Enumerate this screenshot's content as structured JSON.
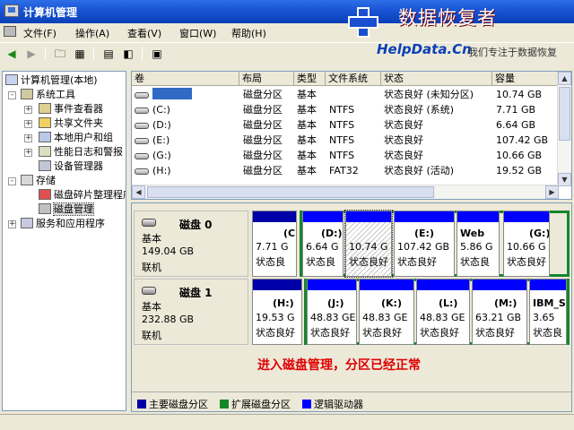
{
  "window": {
    "title": "计算机管理"
  },
  "brand": {
    "cn_name": "数据恢复者",
    "en_name": "HelpData.Cn",
    "slogan": "我们专注于数据恢复"
  },
  "menu": [
    {
      "label": "文件(F)",
      "name": "menu-file"
    },
    {
      "label": "操作(A)",
      "name": "menu-action"
    },
    {
      "label": "查看(V)",
      "name": "menu-view"
    },
    {
      "label": "窗口(W)",
      "name": "menu-window"
    },
    {
      "label": "帮助(H)",
      "name": "menu-help"
    }
  ],
  "toolbar": {
    "back": "back-arrow-icon",
    "forward": "forward-arrow-icon",
    "up": "up-folder-icon",
    "tree": "show-tree-icon",
    "properties": "properties-icon",
    "help": "help-icon",
    "export": "export-list-icon"
  },
  "tree": {
    "root": "计算机管理(本地)",
    "nodes": [
      {
        "label": "系统工具",
        "level": 1,
        "expander": "-"
      },
      {
        "label": "事件查看器",
        "level": 2,
        "expander": "+"
      },
      {
        "label": "共享文件夹",
        "level": 2,
        "expander": "+"
      },
      {
        "label": "本地用户和组",
        "level": 2,
        "expander": "+"
      },
      {
        "label": "性能日志和警报",
        "level": 2,
        "expander": "+"
      },
      {
        "label": "设备管理器",
        "level": 2,
        "expander": ""
      },
      {
        "label": "存储",
        "level": 1,
        "expander": "-"
      },
      {
        "label": "磁盘碎片整理程序",
        "level": 2,
        "expander": ""
      },
      {
        "label": "磁盘管理",
        "level": 2,
        "expander": "",
        "selected": true
      },
      {
        "label": "服务和应用程序",
        "level": 1,
        "expander": "+"
      }
    ]
  },
  "volume_list": {
    "columns": [
      "卷",
      "布局",
      "类型",
      "文件系统",
      "状态",
      "容量"
    ],
    "rows": [
      {
        "volume": "",
        "layout": "磁盘分区",
        "type": "基本",
        "fs": "",
        "status": "状态良好 (未知分区)",
        "capacity": "10.74 GB"
      },
      {
        "volume": "(C:)",
        "layout": "磁盘分区",
        "type": "基本",
        "fs": "NTFS",
        "status": "状态良好 (系统)",
        "capacity": "7.71 GB"
      },
      {
        "volume": "(D:)",
        "layout": "磁盘分区",
        "type": "基本",
        "fs": "NTFS",
        "status": "状态良好",
        "capacity": "6.64 GB"
      },
      {
        "volume": "(E:)",
        "layout": "磁盘分区",
        "type": "基本",
        "fs": "NTFS",
        "status": "状态良好",
        "capacity": "107.42 GB"
      },
      {
        "volume": "(G:)",
        "layout": "磁盘分区",
        "type": "基本",
        "fs": "NTFS",
        "status": "状态良好",
        "capacity": "10.66 GB"
      },
      {
        "volume": "(H:)",
        "layout": "磁盘分区",
        "type": "基本",
        "fs": "FAT32",
        "status": "状态良好 (活动)",
        "capacity": "19.52 GB"
      }
    ]
  },
  "disks": [
    {
      "name": "磁盘 0",
      "kind": "基本",
      "size": "149.04 GB",
      "state": "联机",
      "partitions": [
        {
          "label": "(C:)",
          "size": "7.71 G",
          "status": "状态良",
          "kind": "primary"
        },
        {
          "label": "(D:)",
          "size": "6.64 G",
          "status": "状态良",
          "kind": "logical"
        },
        {
          "label": "",
          "size": "10.74 G",
          "status": "状态良好",
          "kind": "logical",
          "hatched": true
        },
        {
          "label": "(E:)",
          "size": "107.42 GB",
          "status": "状态良好",
          "kind": "logical"
        },
        {
          "label": "Web",
          "size": "5.86 G",
          "status": "状态良",
          "kind": "logical"
        },
        {
          "label": "(G:)",
          "size": "10.66 G",
          "status": "状态良好",
          "kind": "logical"
        }
      ]
    },
    {
      "name": "磁盘 1",
      "kind": "基本",
      "size": "232.88 GB",
      "state": "联机",
      "partitions": [
        {
          "label": "(H:)",
          "size": "19.53 G",
          "status": "状态良好",
          "kind": "primary"
        },
        {
          "label": "(J:)",
          "size": "48.83 GE",
          "status": "状态良好",
          "kind": "logical"
        },
        {
          "label": "(K:)",
          "size": "48.83 GE",
          "status": "状态良好",
          "kind": "logical"
        },
        {
          "label": "(L:)",
          "size": "48.83 GE",
          "status": "状态良好",
          "kind": "logical"
        },
        {
          "label": "(M:)",
          "size": "63.21 GB",
          "status": "状态良好",
          "kind": "logical"
        },
        {
          "label": "IBM_S",
          "size": "3.65",
          "status": "状态良",
          "kind": "logical"
        }
      ]
    }
  ],
  "note": "进入磁盘管理，分区已经正常",
  "legend": [
    {
      "label": "主要磁盘分区",
      "color": "#0000a8"
    },
    {
      "label": "扩展磁盘分区",
      "color": "#14862a"
    },
    {
      "label": "逻辑驱动器",
      "color": "#0000ff"
    }
  ]
}
